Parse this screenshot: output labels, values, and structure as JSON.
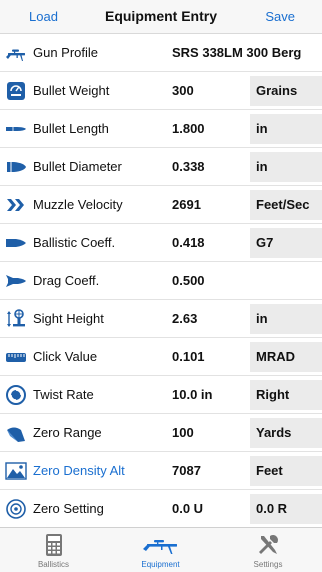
{
  "header": {
    "left_button": "Load",
    "title": "Equipment Entry",
    "right_button": "Save"
  },
  "rows": [
    {
      "icon": "rifle-icon",
      "label": "Gun Profile",
      "value": "SRS 338LM 300 Berg",
      "unit": ""
    },
    {
      "icon": "scale-icon",
      "label": "Bullet Weight",
      "value": "300",
      "unit": "Grains"
    },
    {
      "icon": "bullet-length-icon",
      "label": "Bullet Length",
      "value": "1.800",
      "unit": "in"
    },
    {
      "icon": "bullet-diameter-icon",
      "label": "Bullet Diameter",
      "value": "0.338",
      "unit": "in"
    },
    {
      "icon": "velocity-chevrons-icon",
      "label": "Muzzle Velocity",
      "value": "2691",
      "unit": "Feet/Sec"
    },
    {
      "icon": "bullet-profile-icon",
      "label": "Ballistic Coeff.",
      "value": "0.418",
      "unit": "G7"
    },
    {
      "icon": "drag-bullet-icon",
      "label": "Drag Coeff.",
      "value": "0.500",
      "unit": ""
    },
    {
      "icon": "scope-icon",
      "label": "Sight Height",
      "value": "2.63",
      "unit": "in"
    },
    {
      "icon": "turret-icon",
      "label": "Click Value",
      "value": "0.101",
      "unit": "MRAD"
    },
    {
      "icon": "twist-icon",
      "label": "Twist Rate",
      "value": "10.0 in",
      "unit": "Right"
    },
    {
      "icon": "zero-range-icon",
      "label": "Zero Range",
      "value": "100",
      "unit": "Yards"
    },
    {
      "icon": "density-altitude-icon",
      "label": "Zero Density Alt",
      "value": "7087",
      "unit": "Feet"
    },
    {
      "icon": "zero-setting-icon",
      "label": "Zero Setting",
      "value": "0.0 U",
      "unit": "0.0 R"
    }
  ],
  "tabs": [
    {
      "icon": "calculator-icon",
      "label": "Ballistics",
      "active": false
    },
    {
      "icon": "rifle-icon",
      "label": "Equipment",
      "active": true
    },
    {
      "icon": "tools-icon",
      "label": "Settings",
      "active": false
    }
  ],
  "colors": {
    "accent": "#1a6fd0",
    "icon": "#1f5fa8",
    "unit_background": "#ebebeb",
    "tab_inactive": "#777777"
  }
}
